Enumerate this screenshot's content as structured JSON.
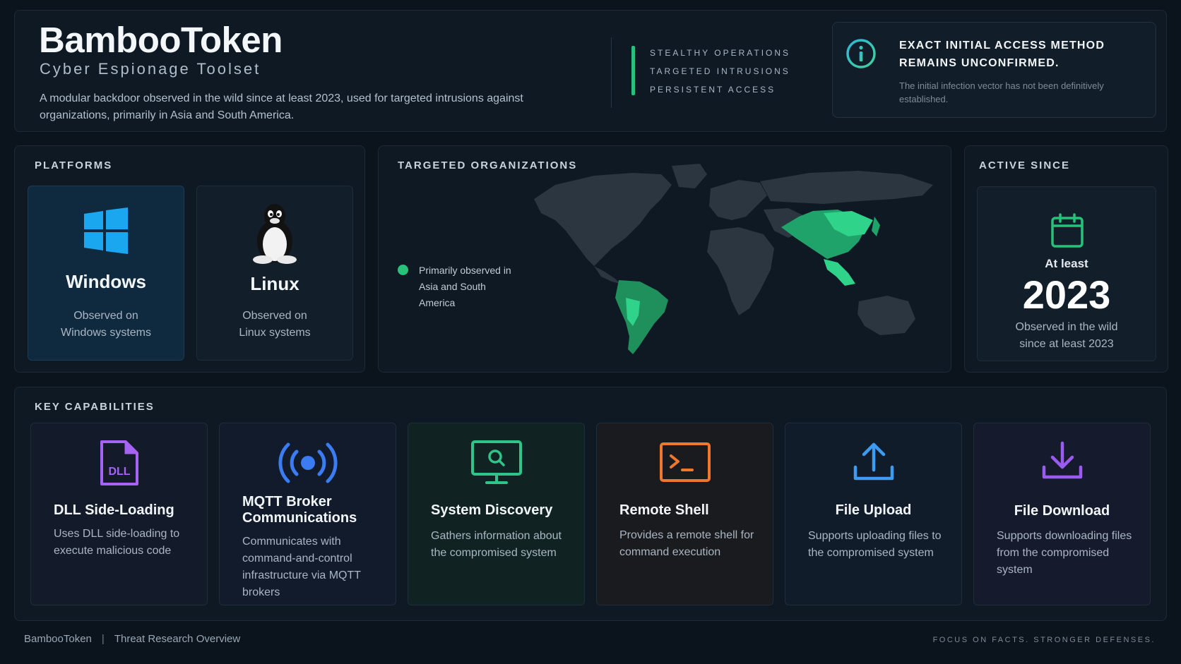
{
  "header": {
    "title": "BambooToken",
    "subtitle": "Cyber Espionage Toolset",
    "description": "A modular backdoor observed in the wild since at least 2023, used for targeted intrusions against organizations, primarily in Asia and South America.",
    "tags": [
      "STEALTHY OPERATIONS",
      "TARGETED INTRUSIONS",
      "PERSISTENT ACCESS"
    ],
    "notice": {
      "icon": "info-icon",
      "title": "EXACT INITIAL ACCESS METHOD REMAINS UNCONFIRMED.",
      "text": "The initial infection vector has not been definitively established."
    }
  },
  "platforms": {
    "label": "PLATFORMS",
    "items": [
      {
        "icon": "windows-icon",
        "name": "Windows",
        "desc": "Observed on Windows systems"
      },
      {
        "icon": "linux-penguin-icon",
        "name": "Linux",
        "desc": "Observed on Linux systems"
      }
    ]
  },
  "orgs": {
    "label": "TARGETED ORGANIZATIONS",
    "legend": "Primarily observed in Asia and South America",
    "highlight_color": "#27c27a"
  },
  "active": {
    "label": "ACTIVE SINCE",
    "icon": "calendar-icon",
    "prefix": "At least",
    "year": "2023",
    "desc": "Observed in the wild since at least 2023"
  },
  "capabilities": {
    "label": "KEY CAPABILITIES",
    "items": [
      {
        "icon": "dll-file-icon",
        "title": "DLL Side-Loading",
        "desc": "Uses DLL side-loading to execute malicious code",
        "color": "#a463f2"
      },
      {
        "icon": "broadcast-icon",
        "title": "MQTT Broker Communications",
        "desc": "Communicates with command-and-control infrastructure via MQTT brokers",
        "color": "#3b7cf2"
      },
      {
        "icon": "monitor-search-icon",
        "title": "System Discovery",
        "desc": "Gathers information about the compromised system",
        "color": "#2fc48a"
      },
      {
        "icon": "terminal-icon",
        "title": "Remote Shell",
        "desc": "Provides a remote shell for command execution",
        "color": "#f0772e"
      },
      {
        "icon": "upload-icon",
        "title": "File Upload",
        "desc": "Supports uploading files to the compromised system",
        "color": "#3d9bf2"
      },
      {
        "icon": "download-icon",
        "title": "File Download",
        "desc": "Supports downloading files from the compromised system",
        "color": "#9a5cf0"
      }
    ]
  },
  "footer": {
    "brand": "BambooToken",
    "section": "Threat Research Overview",
    "tagline": "FOCUS ON FACTS. STRONGER DEFENSES."
  }
}
